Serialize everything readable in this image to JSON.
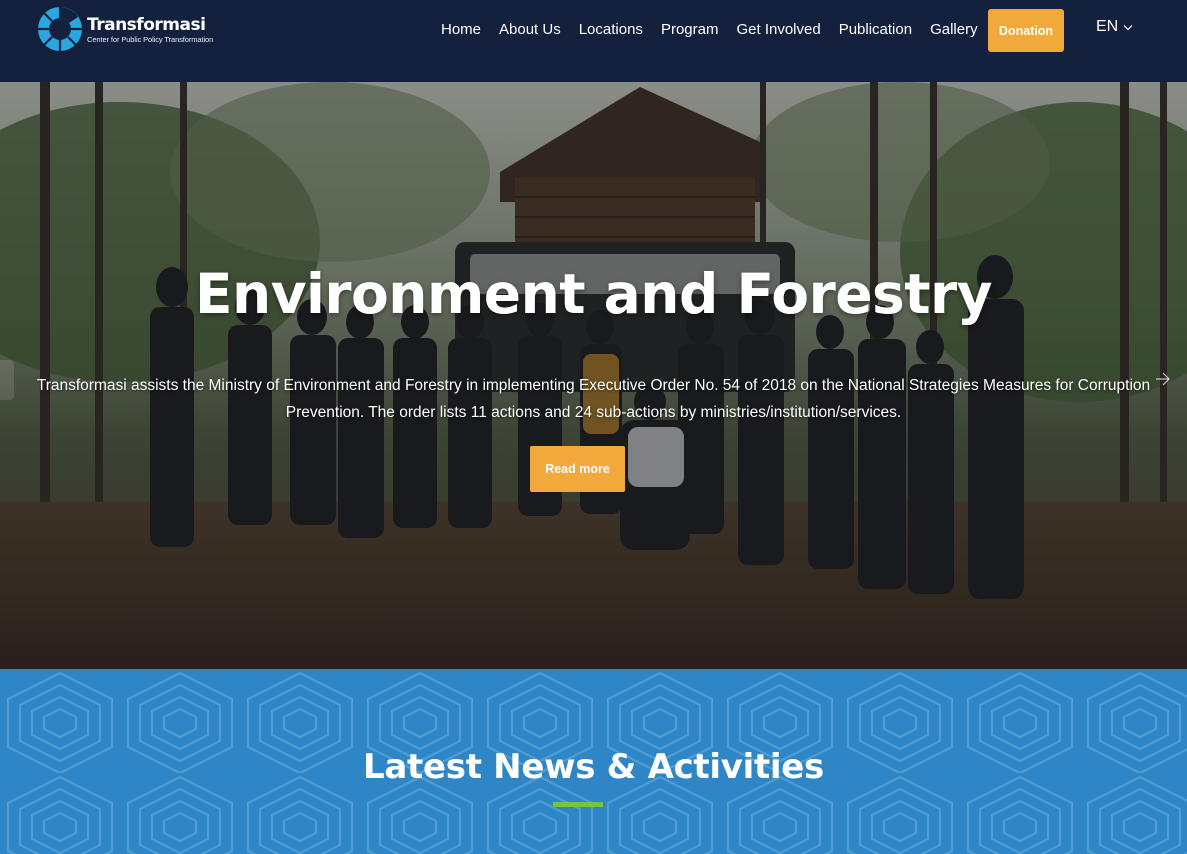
{
  "header": {
    "logo": {
      "name": "Transformasi",
      "tagline": "Center for Public Policy Transformation",
      "icon": "transformasi-logo-icon"
    },
    "nav": [
      {
        "label": "Home"
      },
      {
        "label": "About Us"
      },
      {
        "label": "Locations"
      },
      {
        "label": "Program"
      },
      {
        "label": "Get Involved"
      },
      {
        "label": "Publication"
      },
      {
        "label": "Gallery"
      }
    ],
    "donate_label": "Donation",
    "language": "EN"
  },
  "hero": {
    "title": "Environment and Forestry",
    "description": "Transformasi assists the Ministry of Environment and Forestry in implementing Executive Order No. 54 of 2018 on the National Strategies Measures for Corruption Prevention. The order lists 11 actions and 24 sub-actions by ministries/institution/services.",
    "button_label": "Read more"
  },
  "news": {
    "title": "Latest News & Activities"
  },
  "colors": {
    "header_bg": "#13213f",
    "accent": "#f2a93b",
    "news_bg": "#2f86c7",
    "underline": "#7dc142"
  }
}
